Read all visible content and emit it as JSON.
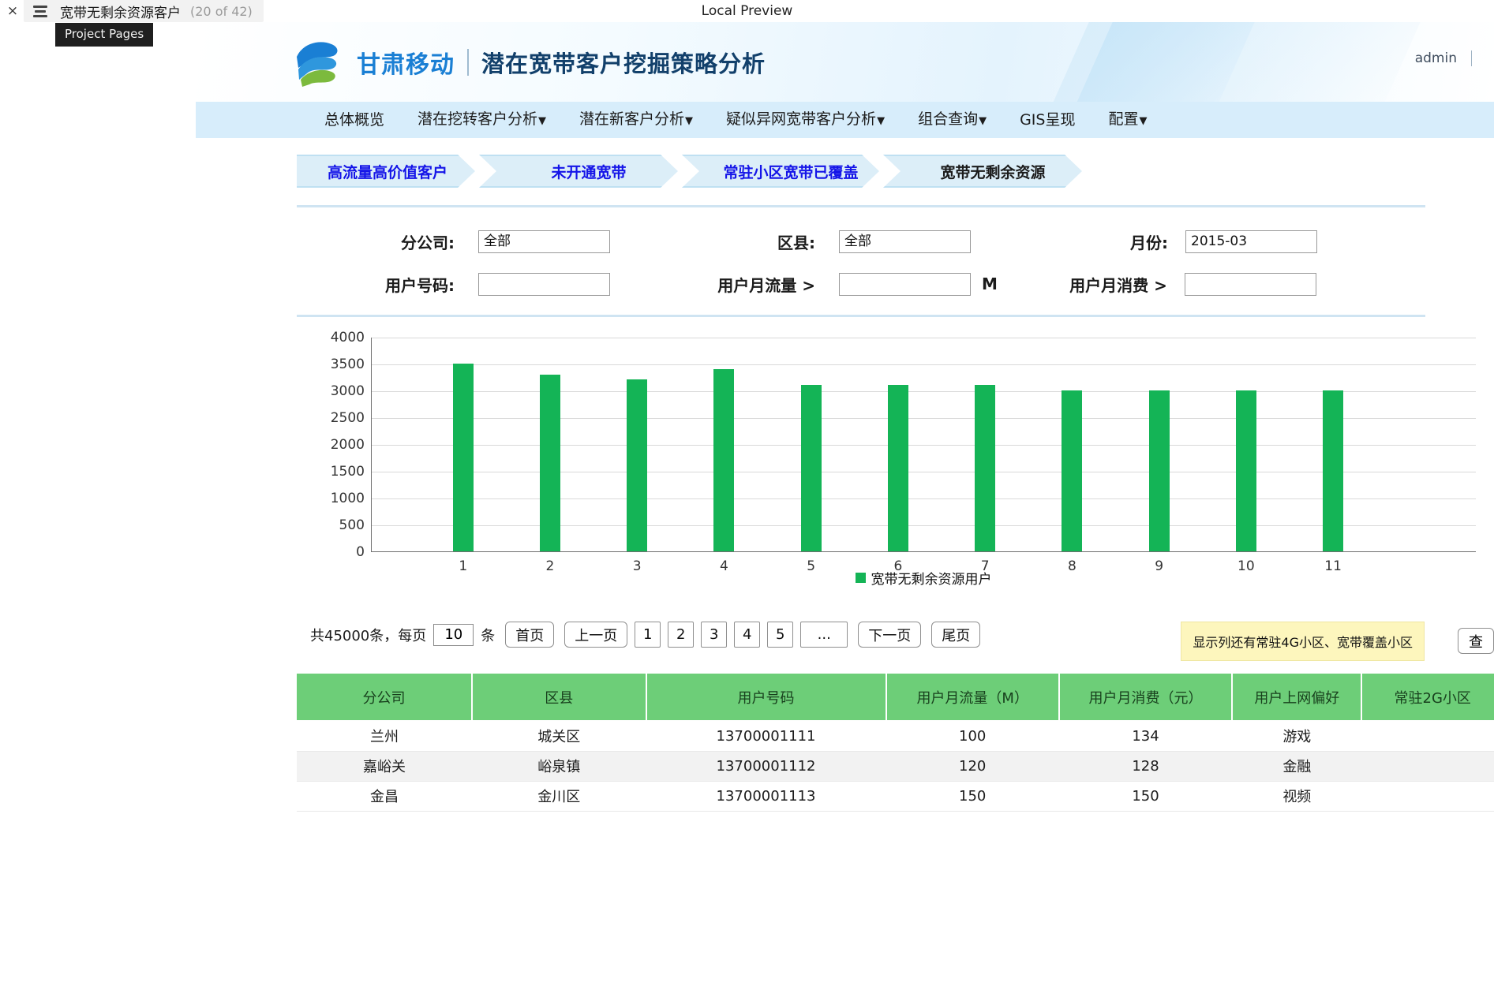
{
  "chrome": {
    "close_label": "×",
    "tab_title": "宽带无剩余资源客户",
    "tab_count": "(20 of 42)",
    "preview_label": "Local Preview",
    "tooltip": "Project Pages"
  },
  "header": {
    "brand_cn": "甘肃移动",
    "title": "潜在宽带客户挖掘策略分析",
    "user": "admin"
  },
  "nav": {
    "items": [
      {
        "label": "总体概览",
        "caret": false
      },
      {
        "label": "潜在挖转客户分析",
        "caret": true
      },
      {
        "label": "潜在新客户分析",
        "caret": true
      },
      {
        "label": "疑似异网宽带客户分析",
        "caret": true
      },
      {
        "label": "组合查询",
        "caret": true
      },
      {
        "label": "GIS呈现",
        "caret": false
      },
      {
        "label": "配置",
        "caret": true
      }
    ]
  },
  "steps": [
    {
      "label": "高流量高价值客户",
      "active": false
    },
    {
      "label": "未开通宽带",
      "active": false
    },
    {
      "label": "常驻小区宽带已覆盖",
      "active": false
    },
    {
      "label": "宽带无剩余资源",
      "active": true
    }
  ],
  "filters": {
    "branch_label": "分公司:",
    "branch_value": "全部",
    "county_label": "区县:",
    "county_value": "全部",
    "month_label": "月份:",
    "month_value": "2015-03",
    "phone_label": "用户号码:",
    "phone_value": "",
    "flow_label": "用户月流量 >",
    "flow_value": "",
    "flow_unit": "M",
    "spend_label": "用户月消费 >",
    "spend_value": "",
    "chevron": "⌄"
  },
  "chart_data": {
    "type": "bar",
    "title": "",
    "xlabel": "",
    "ylabel": "",
    "categories": [
      "1",
      "2",
      "3",
      "4",
      "5",
      "6",
      "7",
      "8",
      "9",
      "10",
      "11"
    ],
    "values": [
      3500,
      3300,
      3200,
      3400,
      3100,
      3100,
      3100,
      3000,
      3000,
      3000,
      3000
    ],
    "ylim": [
      0,
      4000
    ],
    "yticks": [
      0,
      500,
      1000,
      1500,
      2000,
      2500,
      3000,
      3500,
      4000
    ],
    "grid": true,
    "legend": [
      "宽带无剩余资源用户"
    ],
    "legend_position": "bottom",
    "series_color": "#14b456"
  },
  "pager": {
    "total_text": "共45000条，每页",
    "page_size": "10",
    "unit_text": "条",
    "first": "首页",
    "prev": "上一页",
    "pages": [
      "1",
      "2",
      "3",
      "4",
      "5"
    ],
    "ellipsis": "...",
    "next": "下一页",
    "last": "尾页",
    "note": "显示列还有常驻4G小区、宽带覆盖小区",
    "query": "查"
  },
  "table": {
    "columns": [
      "分公司",
      "区县",
      "用户号码",
      "用户月流量（M）",
      "用户月消费（元）",
      "用户上网偏好",
      "常驻2G小区"
    ],
    "rows": [
      [
        "兰州",
        "城关区",
        "13700001111",
        "100",
        "134",
        "游戏",
        ""
      ],
      [
        "嘉峪关",
        "峪泉镇",
        "13700001112",
        "120",
        "128",
        "金融",
        ""
      ],
      [
        "金昌",
        "金川区",
        "13700001113",
        "150",
        "150",
        "视频",
        ""
      ]
    ]
  }
}
